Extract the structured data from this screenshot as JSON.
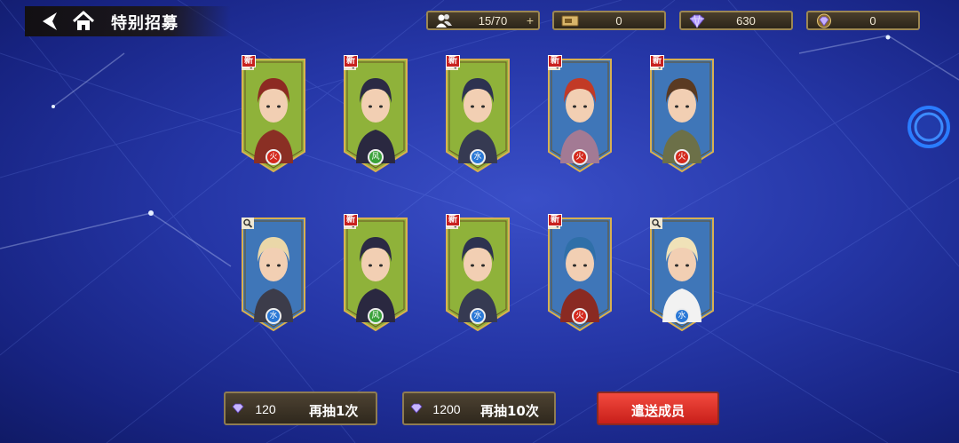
{
  "header": {
    "title": "特别招募"
  },
  "resources": [
    {
      "icon": "party-members-icon",
      "value": "15/70",
      "plus": "+"
    },
    {
      "icon": "ticket-icon",
      "value": "0"
    },
    {
      "icon": "gem-icon",
      "value": "630"
    },
    {
      "icon": "paid-gem-icon",
      "value": "0"
    }
  ],
  "cards": [
    {
      "new_label": "新",
      "element": "火",
      "frame": "green",
      "portrait": "armored-red-knight"
    },
    {
      "new_label": "新",
      "element": "风",
      "frame": "green",
      "portrait": "soldier-cap"
    },
    {
      "new_label": "新",
      "element": "水",
      "frame": "green",
      "portrait": "masked-soldier"
    },
    {
      "new_label": "新",
      "element": "火",
      "frame": "blue",
      "portrait": "red-haired-youth"
    },
    {
      "new_label": "新",
      "element": "火",
      "frame": "blue",
      "portrait": "officer-tie"
    },
    {
      "new_label": "",
      "element": "水",
      "frame": "blue",
      "portrait": "blonde-goggles-girl"
    },
    {
      "new_label": "新",
      "element": "风",
      "frame": "green",
      "portrait": "soldier-cap"
    },
    {
      "new_label": "新",
      "element": "水",
      "frame": "green",
      "portrait": "masked-soldier"
    },
    {
      "new_label": "新",
      "element": "火",
      "frame": "blue",
      "portrait": "blue-haired-youth"
    },
    {
      "new_label": "",
      "element": "水",
      "frame": "blue",
      "portrait": "blonde-woman"
    }
  ],
  "buttons": {
    "draw_one": {
      "cost": "120",
      "label": "再抽1次"
    },
    "draw_ten": {
      "cost": "1200",
      "label": "再抽10次"
    },
    "dismiss": {
      "label": "遣送成员"
    }
  },
  "colors": {
    "fire": "#d42a1e",
    "wind": "#3aa23a",
    "water": "#2a78d6",
    "frame_gold": "#d8b050",
    "green_bg": "#8fb23a",
    "blue_bg": "#3f76b8"
  }
}
